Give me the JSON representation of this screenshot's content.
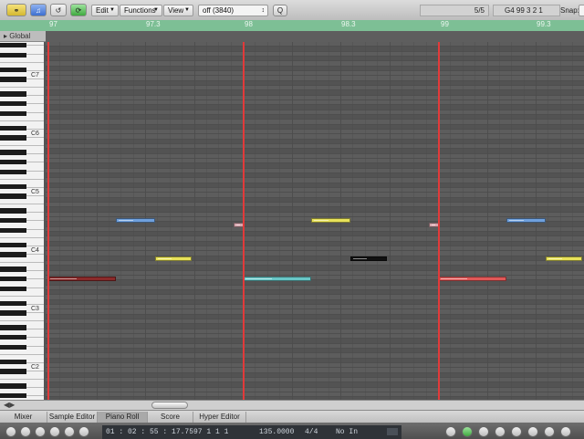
{
  "toolbar": {
    "edit_label": "Edit",
    "functions_label": "Functions",
    "view_label": "View",
    "quantize_value": "off (3840)",
    "track_count": "5/5",
    "position_readout": "G4   99 3 2 1",
    "snap_label": "Snap:"
  },
  "ruler": {
    "marks": [
      "97",
      "97.3",
      "98",
      "98.3",
      "99",
      "99.3"
    ]
  },
  "global_track": {
    "label": "Global"
  },
  "keyboard": {
    "octaves": [
      "C7",
      "C6",
      "C5",
      "C4",
      "C3",
      "C2"
    ]
  },
  "notes": [
    {
      "color": "#8a2a2a",
      "pitch_row": 41,
      "start_beat": 0.0,
      "length_beats": 1.4
    },
    {
      "color": "#6fa0dd",
      "pitch_row": 29,
      "start_beat": 1.4,
      "length_beats": 0.8
    },
    {
      "color": "#e8e25a",
      "pitch_row": 37,
      "start_beat": 2.2,
      "length_beats": 0.75
    },
    {
      "color": "#d6a6ae",
      "pitch_row": 30,
      "start_beat": 3.82,
      "length_beats": 0.22
    },
    {
      "color": "#69c7c7",
      "pitch_row": 41,
      "start_beat": 4.0,
      "length_beats": 1.4
    },
    {
      "color": "#e8e25a",
      "pitch_row": 29,
      "start_beat": 5.4,
      "length_beats": 0.8
    },
    {
      "color": "#111111",
      "pitch_row": 37,
      "start_beat": 6.2,
      "length_beats": 0.75
    },
    {
      "color": "#d6a6ae",
      "pitch_row": 30,
      "start_beat": 7.82,
      "length_beats": 0.22
    },
    {
      "color": "#e05858",
      "pitch_row": 41,
      "start_beat": 8.0,
      "length_beats": 1.4
    },
    {
      "color": "#6fa0dd",
      "pitch_row": 29,
      "start_beat": 9.4,
      "length_beats": 0.8
    },
    {
      "color": "#e8e25a",
      "pitch_row": 37,
      "start_beat": 10.2,
      "length_beats": 0.75
    }
  ],
  "bottom_tabs": [
    "Mixer",
    "Sample Editor",
    "Piano Roll",
    "Score",
    "Hyper Editor"
  ],
  "active_tab": "Piano Roll",
  "transport": {
    "smpte": "01 : 02 : 55 : 17.75",
    "bar_position": "97    1    1    1",
    "tempo": "135.0000",
    "signature": "4/4",
    "input": "No In"
  }
}
